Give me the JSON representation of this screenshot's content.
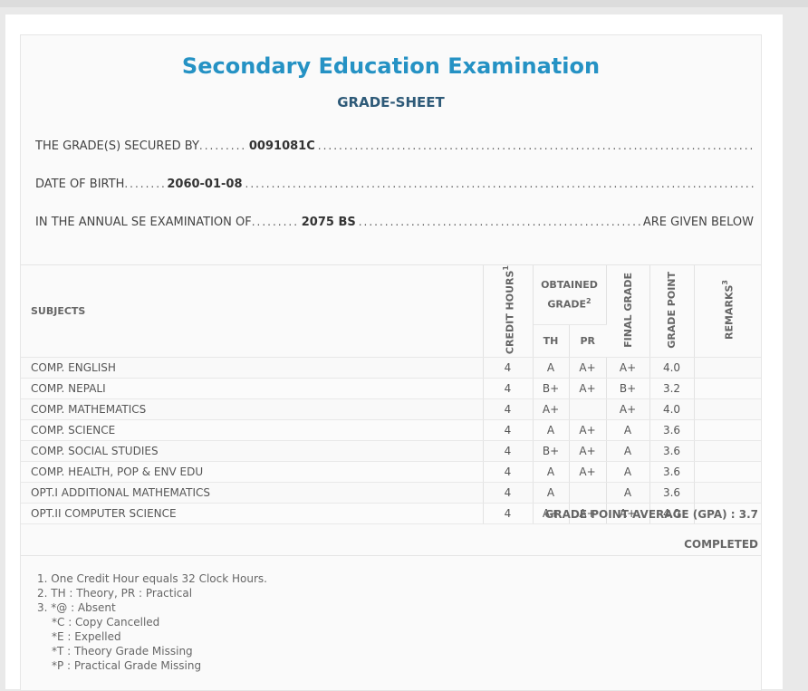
{
  "header": {
    "title": "Secondary Education Examination",
    "subtitle": "GRADE-SHEET"
  },
  "info": {
    "secured_by_label": "THE GRADE(S) SECURED BY",
    "symbol_no": "0091081C",
    "dob_label": "DATE OF BIRTH",
    "dob": "2060-01-08",
    "exam_label": "IN THE ANNUAL SE EXAMINATION OF",
    "exam_year": "2075 BS",
    "exam_tail": "ARE GIVEN BELOW"
  },
  "table": {
    "headers": {
      "subjects": "SUBJECTS",
      "credit_hours": "CREDIT HOURS",
      "credit_hours_note": "1",
      "obtained_grade": "OBTAINED GRADE",
      "obtained_grade_note": "2",
      "th": "TH",
      "pr": "PR",
      "final_grade": "FINAL GRADE",
      "grade_point": "GRADE POINT",
      "remarks": "REMARKS",
      "remarks_note": "3"
    },
    "rows": [
      {
        "subject": "COMP. ENGLISH",
        "credit": "4",
        "th": "A",
        "pr": "A+",
        "final": "A+",
        "gp": "4.0",
        "remarks": ""
      },
      {
        "subject": "COMP. NEPALI",
        "credit": "4",
        "th": "B+",
        "pr": "A+",
        "final": "B+",
        "gp": "3.2",
        "remarks": ""
      },
      {
        "subject": "COMP. MATHEMATICS",
        "credit": "4",
        "th": "A+",
        "pr": "",
        "final": "A+",
        "gp": "4.0",
        "remarks": ""
      },
      {
        "subject": "COMP. SCIENCE",
        "credit": "4",
        "th": "A",
        "pr": "A+",
        "final": "A",
        "gp": "3.6",
        "remarks": ""
      },
      {
        "subject": "COMP. SOCIAL STUDIES",
        "credit": "4",
        "th": "B+",
        "pr": "A+",
        "final": "A",
        "gp": "3.6",
        "remarks": ""
      },
      {
        "subject": "COMP. HEALTH, POP & ENV EDU",
        "credit": "4",
        "th": "A",
        "pr": "A+",
        "final": "A",
        "gp": "3.6",
        "remarks": ""
      },
      {
        "subject": "OPT.I ADDITIONAL MATHEMATICS",
        "credit": "4",
        "th": "A",
        "pr": "",
        "final": "A",
        "gp": "3.6",
        "remarks": ""
      },
      {
        "subject": "OPT.II COMPUTER SCIENCE",
        "credit": "4",
        "th": "A+",
        "pr": "A+",
        "final": "A+",
        "gp": "4.0",
        "remarks": ""
      }
    ]
  },
  "summary": {
    "gpa_text": "GRADE POINT AVERAGE (GPA) : 3.7",
    "status": "COMPLETED"
  },
  "notes": [
    "1. One Credit Hour equals 32 Clock Hours.",
    "2. TH : Theory, PR : Practical",
    "3. *@ : Absent",
    "*C : Copy Cancelled",
    "*E : Expelled",
    "*T : Theory Grade Missing",
    "*P : Practical Grade Missing"
  ]
}
